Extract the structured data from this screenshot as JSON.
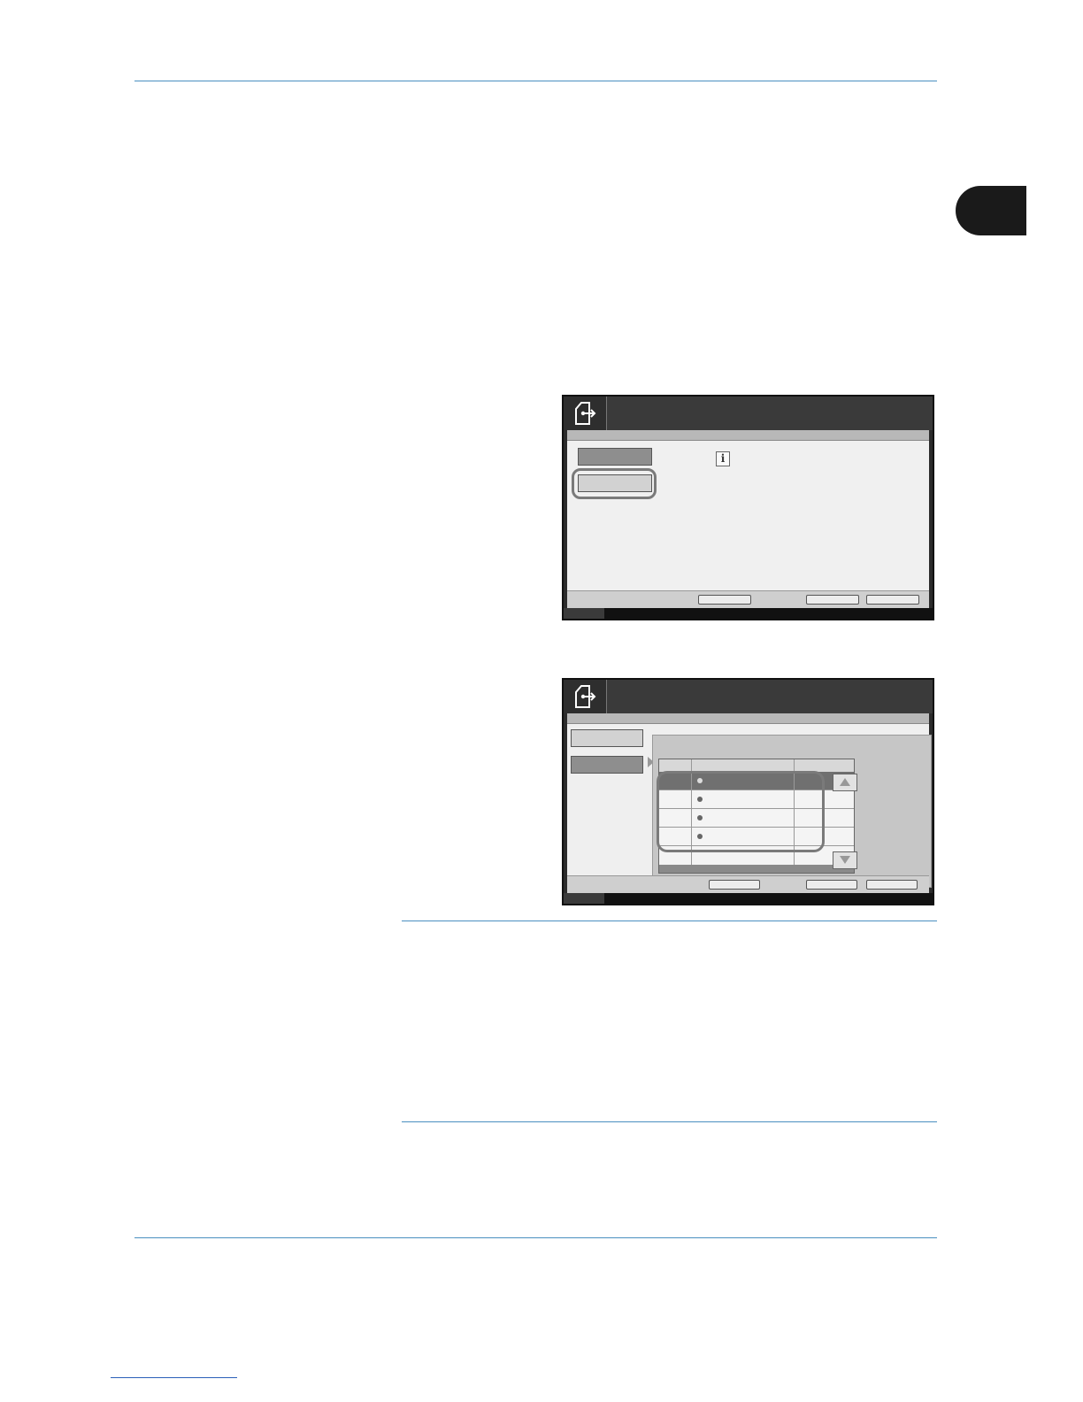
{
  "page": {
    "colors": {
      "rule": "#4a8fc0",
      "tab": "#1a1a1a",
      "link": "#2b5fb8"
    }
  },
  "screen1": {
    "icon": "document-send-icon",
    "info_icon_glyph": "i"
  },
  "screen2": {
    "icon": "document-send-icon",
    "list_rows": 5,
    "selected_row": 1
  }
}
